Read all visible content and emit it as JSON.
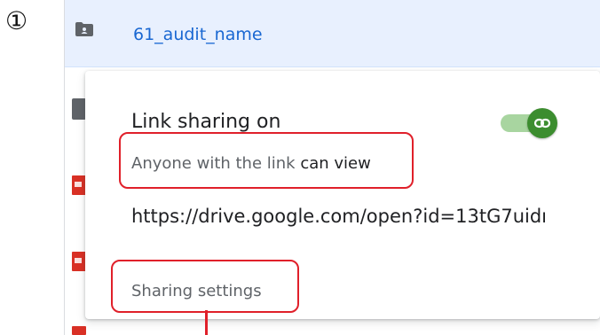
{
  "step_marker": "①",
  "file": {
    "name": "61_audit_name"
  },
  "popup": {
    "title": "Link sharing on",
    "access_prefix": "Anyone with the link",
    "access_level": "can view",
    "link_url": "https://drive.google.com/open?id=13tG7uidı",
    "settings_label": "Sharing settings"
  },
  "colors": {
    "selected_row": "#e8f0fe",
    "file_name": "#1967d2",
    "toggle_on": "#3c8d2f",
    "annotation": "#e0202a"
  },
  "icons": [
    "shared-folder-icon",
    "pdf-file-icon",
    "link-icon"
  ]
}
